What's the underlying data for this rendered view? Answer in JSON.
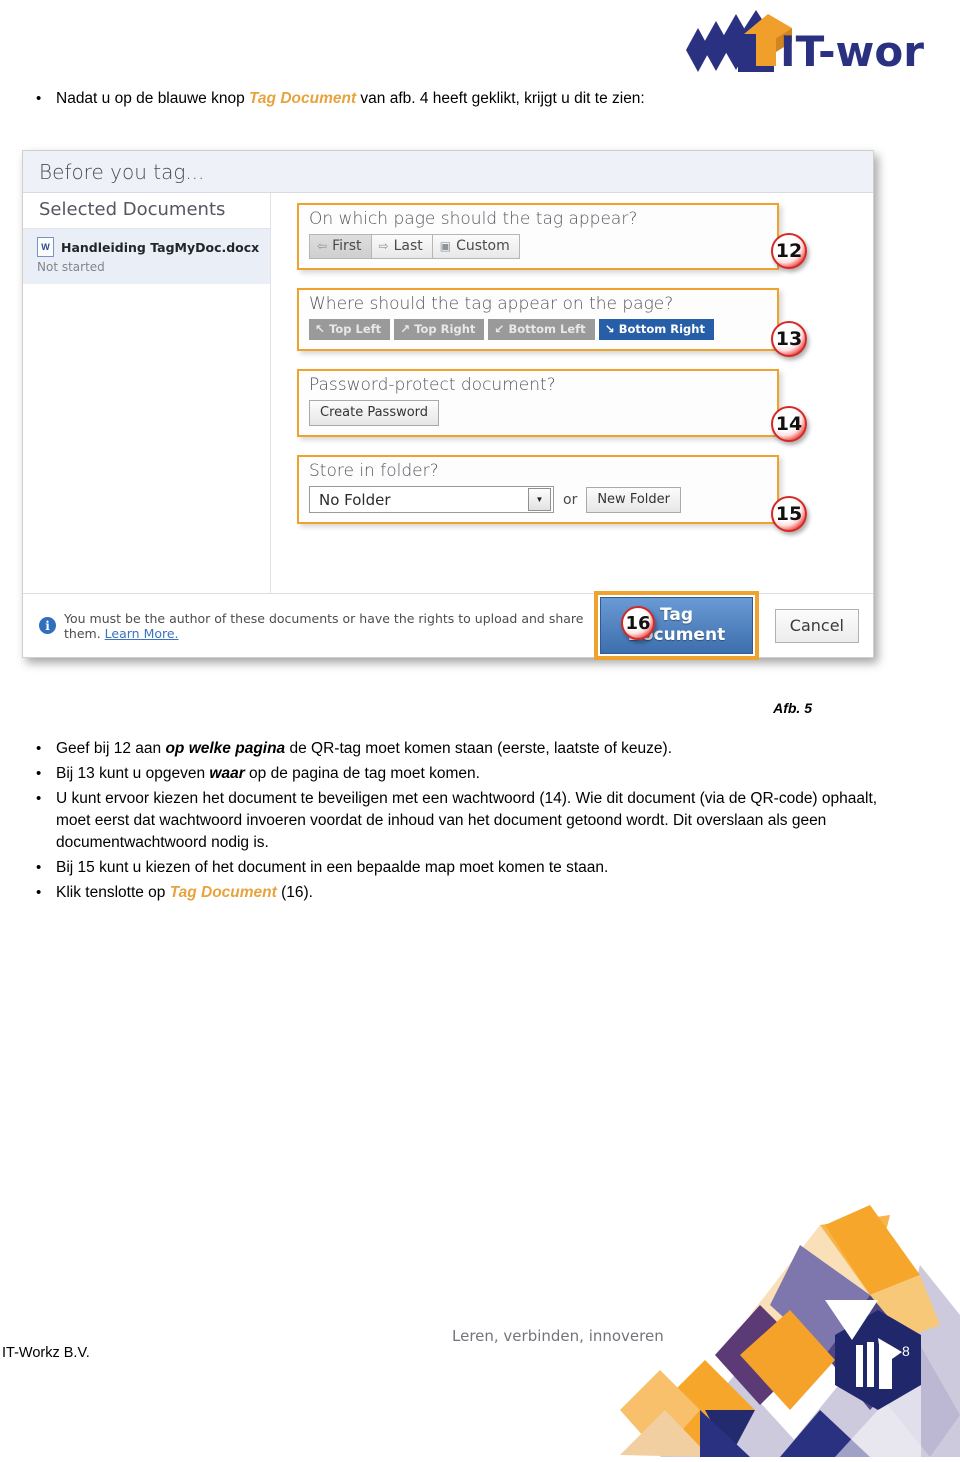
{
  "header": {
    "logo_text": "IT-workz",
    "logo_icon": "it-workz-logo-icon"
  },
  "intro": {
    "bullet": "•",
    "text_before": "Nadat u op de blauwe knop ",
    "accent": "Tag Document",
    "text_after": " van afb. 4 heeft geklikt, krijgt u dit te zien:"
  },
  "dialog": {
    "title": "Before you tag...",
    "documents_pane": {
      "header": "Selected Documents",
      "item": {
        "icon": "word-document-icon",
        "name": "Handleiding TagMyDoc.docx",
        "status": "Not started"
      }
    },
    "sections": [
      {
        "label": "On which page should the tag appear?",
        "buttons": [
          {
            "label": "First",
            "icon": "⇦",
            "state": "pressed"
          },
          {
            "label": "Last",
            "icon": "⇨",
            "state": "normal"
          },
          {
            "label": "Custom",
            "icon": "▣",
            "state": "normal"
          }
        ],
        "callout": "12"
      },
      {
        "label": "Where should the tag appear on the page?",
        "buttons": [
          {
            "label": "Top Left",
            "icon": "↖",
            "state": "normal"
          },
          {
            "label": "Top Right",
            "icon": "↗",
            "state": "normal"
          },
          {
            "label": "Bottom Left",
            "icon": "↙",
            "state": "normal"
          },
          {
            "label": "Bottom Right",
            "icon": "↘",
            "state": "active"
          }
        ],
        "callout": "13"
      },
      {
        "label": "Password-protect document?",
        "button": "Create Password",
        "callout": "14"
      },
      {
        "label": "Store in folder?",
        "combo_value": "No Folder",
        "combo_arrow_icon": "chevron-down-icon",
        "or_word": "or",
        "new_folder_button": "New Folder",
        "callout": "15"
      }
    ],
    "footer": {
      "info_icon": "info-icon",
      "note": "You must be the author of these documents or have the rights to upload and share them.",
      "link": "Learn More.",
      "primary_button": "Tag Document",
      "secondary_button": "Cancel",
      "callout": "16"
    }
  },
  "figure_caption": "Afb. 5",
  "body_bullets": [
    {
      "bullet": "•",
      "parts": [
        {
          "text": "Geef bij 12 aan ",
          "style": "normal"
        },
        {
          "text": "op welke pagina",
          "style": "bold-italic"
        },
        {
          "text": " de QR-tag moet komen staan (eerste, laatste of keuze).",
          "style": "normal"
        }
      ]
    },
    {
      "bullet": "•",
      "parts": [
        {
          "text": "Bij 13 kunt u opgeven ",
          "style": "normal"
        },
        {
          "text": "waar",
          "style": "bold-italic"
        },
        {
          "text": " op de pagina de tag moet komen.",
          "style": "normal"
        }
      ]
    },
    {
      "bullet": "•",
      "parts": [
        {
          "text": "U kunt ervoor kiezen het document te beveiligen met een wachtwoord (14). Wie dit document (via de QR-code) ophaalt, moet eerst dat wachtwoord invoeren voordat de inhoud  van het document getoond wordt. Dit overslaan als geen documentwachtwoord nodig is.",
          "style": "normal"
        }
      ]
    },
    {
      "bullet": "•",
      "parts": [
        {
          "text": "Bij 15 kunt u kiezen of het document in een bepaalde map moet komen te staan.",
          "style": "normal"
        }
      ]
    },
    {
      "bullet": "•",
      "parts": [
        {
          "text": "Klik tenslotte op ",
          "style": "normal"
        },
        {
          "text": "Tag Document",
          "style": "accent"
        },
        {
          "text": " (16).",
          "style": "normal"
        }
      ]
    }
  ],
  "page_footer": {
    "company": "IT-Workz B.V.",
    "tagline": "Leren, verbinden, innoveren",
    "page_number": "8"
  },
  "colors": {
    "accent_orange": "#e8a33d",
    "highlight_orange": "#eda32e",
    "brand_navy": "#2b3181",
    "brand_orange": "#f0a02a",
    "primary_blue": "#3d6fae",
    "active_blue": "#265fa8",
    "callout_red": "#d42a26"
  }
}
